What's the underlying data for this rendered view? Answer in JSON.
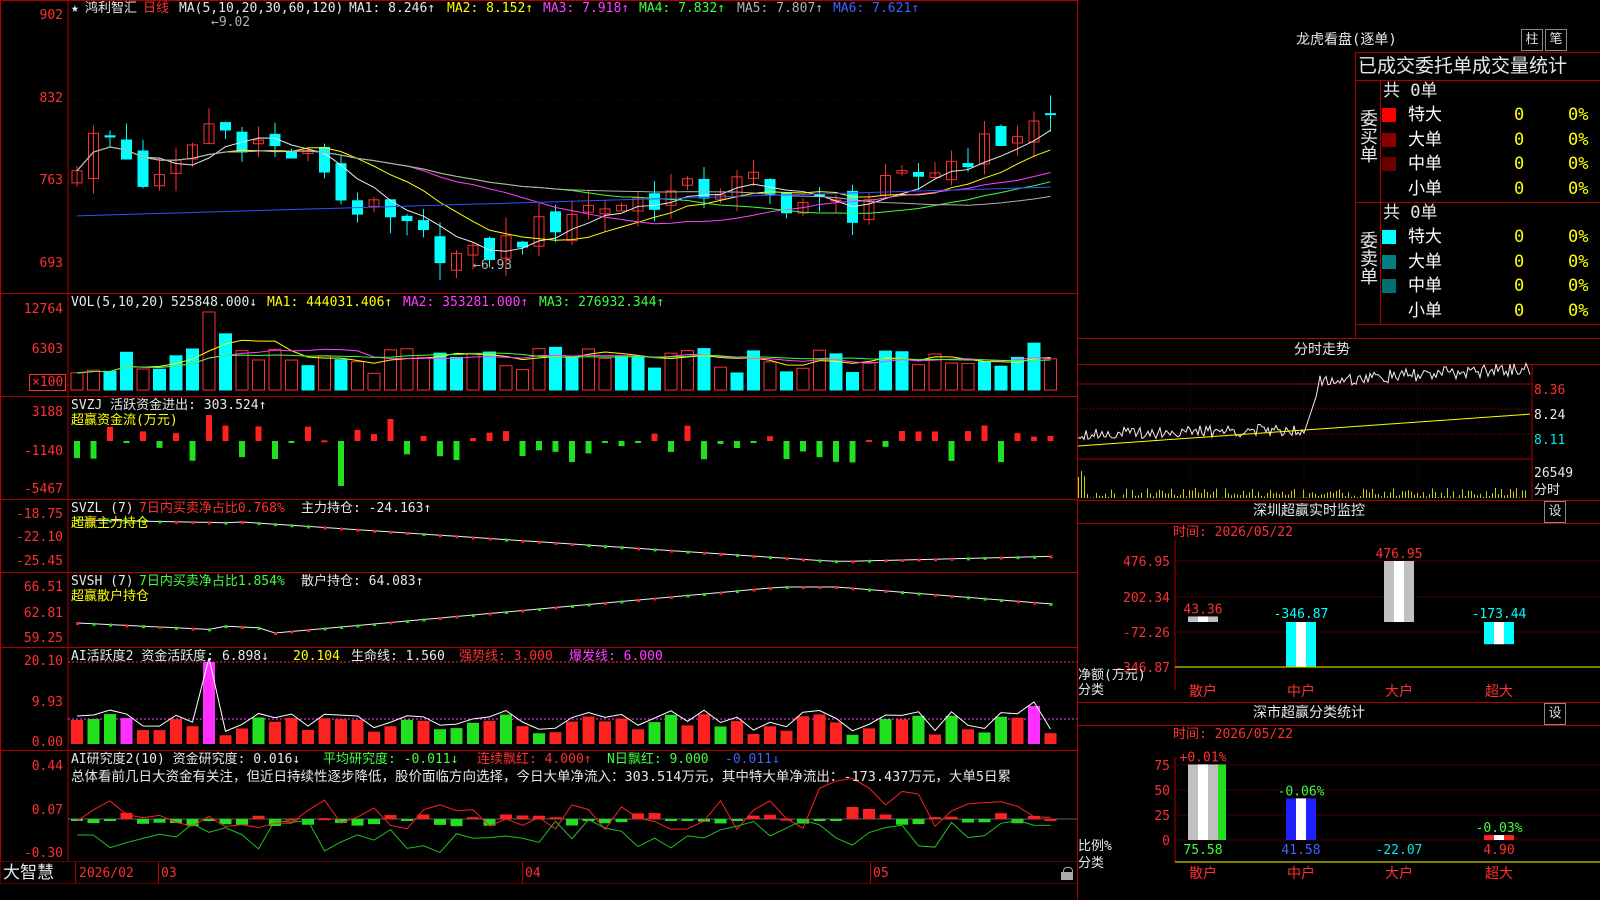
{
  "left": {
    "kline": {
      "title_star": "★",
      "stock_name": "鸿利智汇",
      "period": "日线",
      "ma_params": "MA(5,10,20,30,60,120)",
      "ma1": "MA1: 8.246↑",
      "ma2": "MA2: 8.152↑",
      "ma3": "MA3: 7.918↑",
      "ma4": "MA4: 7.832↑",
      "ma5": "MA5: 7.807↑",
      "ma6": "MA6: 7.621↑",
      "high_mark": "9.02",
      "low_mark": "6.93",
      "y_ticks": [
        "902",
        "832",
        "763",
        "693"
      ]
    },
    "vol": {
      "header": "VOL(5,10,20)",
      "value": "525848.000↓",
      "ma1": "MA1: 444031.406↑",
      "ma2": "MA2: 353281.000↑",
      "ma3": "MA3: 276932.344↑",
      "y_ticks": [
        "12764",
        "6303",
        "×100"
      ]
    },
    "svzj": {
      "header": "SVZJ  活跃资金进出: 303.524↑",
      "subtitle": "超赢资金流(万元)",
      "y_ticks": [
        "3188",
        "-1140",
        "-5467"
      ]
    },
    "svzl": {
      "header_a": "SVZL (7)",
      "header_b": "7日内买卖净占比0.768%",
      "header_c": "主力持仓: -24.163↑",
      "subtitle": "超赢主力持仓",
      "y_ticks": [
        "-18.75",
        "-22.10",
        "-25.45"
      ]
    },
    "svsh": {
      "header_a": "SVSH (7)",
      "header_b": "7日内买卖净占比1.854%",
      "header_c": "散户持仓: 64.083↑",
      "subtitle": "超赢散户持仓",
      "y_ticks": [
        "66.51",
        "62.81",
        "59.25"
      ]
    },
    "ai2": {
      "header_a": "AI活跃度2 资金活跃度: 6.898↓",
      "header_b": "20.104",
      "header_c": "生命线: 1.560",
      "header_d": "强势线: 3.000",
      "header_e": "爆发线: 6.000",
      "y_ticks": [
        "20.10",
        "9.93",
        "0.00"
      ]
    },
    "ai_res": {
      "header_a": "AI研究度2(10) 资金研究度: 0.016↓",
      "header_b": "平均研究度: -0.011↓",
      "header_c": "连续飘红: 4.000↑",
      "header_d": "N日飘红: 9.000",
      "header_e": "-0.011↓",
      "summary": "总体看前几日大资金有关注，但近日持续性逐步降低，股价面临方向选择，今日大单净流入：303.514万元，其中特大单净流出：-173.437万元，大单5日累",
      "y_ticks": [
        "0.44",
        "0.07",
        "-0.30"
      ]
    },
    "footer": {
      "brand": "大智慧",
      "dates": [
        "2026/02",
        "03",
        "04",
        "05"
      ]
    }
  },
  "right": {
    "lhb": {
      "title": "龙虎看盘(逐单)",
      "btn_col": "柱",
      "btn_bi": "笔",
      "table_header": "已成交委托单成交量统计",
      "buy_label": "委买单",
      "sell_label": "委卖单",
      "buy_total": "共 0单",
      "sell_total": "共 0单",
      "buy_rows": [
        {
          "label": "特大",
          "count": "0",
          "pct": "0%",
          "color": "#ff0000"
        },
        {
          "label": "大单",
          "count": "0",
          "pct": "0%",
          "color": "#8a0000"
        },
        {
          "label": "中单",
          "count": "0",
          "pct": "0%",
          "color": "#6a0000"
        },
        {
          "label": "小单",
          "count": "0",
          "pct": "0%",
          "color": ""
        }
      ],
      "sell_rows": [
        {
          "label": "特大",
          "count": "0",
          "pct": "0%",
          "color": "#00ffff"
        },
        {
          "label": "大单",
          "count": "0",
          "pct": "0%",
          "color": "#008080"
        },
        {
          "label": "中单",
          "count": "0",
          "pct": "0%",
          "color": "#007070"
        },
        {
          "label": "小单",
          "count": "0",
          "pct": "0%",
          "color": ""
        }
      ]
    },
    "intraday": {
      "title": "分时走势",
      "prices": [
        "8.36",
        "8.24",
        "8.11"
      ],
      "volume": "26549",
      "vol_label": "分时"
    },
    "monitor": {
      "title": "深圳超赢实时监控",
      "btn": "设",
      "time": "时间: 2026/05/22",
      "y_ticks": [
        "476.95",
        "202.34",
        "-72.26",
        "-346.87"
      ],
      "unit": "净额(万元)",
      "cat_label": "分类",
      "categories": [
        "散户",
        "中户",
        "大户",
        "超大"
      ],
      "values": [
        43.36,
        -346.87,
        476.95,
        -173.44
      ],
      "value_labels": [
        "43.36",
        "-346.87",
        "476.95",
        "-173.44"
      ]
    },
    "classify": {
      "title": "深市超赢分类统计",
      "btn": "设",
      "time": "时间: 2026/05/22",
      "y_ticks": [
        "75",
        "50",
        "25",
        "0"
      ],
      "unit": "比例%",
      "cat_label": "分类",
      "categories": [
        "散户",
        "中户",
        "大户",
        "超大"
      ],
      "top_labels": [
        "+0.01%",
        "-0.06%",
        "",
        "-0.03%"
      ],
      "values": [
        75.58,
        41.58,
        -22.07,
        4.9
      ],
      "value_labels": [
        "75.58",
        "41.58",
        "-22.07",
        "4.90"
      ]
    }
  }
}
